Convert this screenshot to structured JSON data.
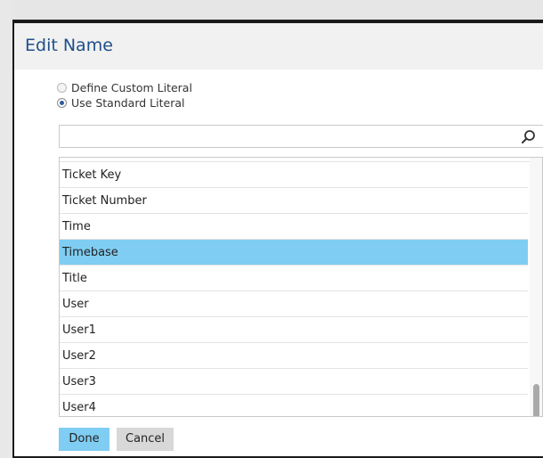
{
  "dialog": {
    "title": "Edit Name",
    "options": [
      {
        "label": "Define Custom Literal",
        "checked": false
      },
      {
        "label": "Use Standard Literal",
        "checked": true
      }
    ],
    "search": {
      "value": "",
      "placeholder": ""
    },
    "list": [
      {
        "label": "Ticket Key",
        "selected": false
      },
      {
        "label": "Ticket Number",
        "selected": false
      },
      {
        "label": "Time",
        "selected": false
      },
      {
        "label": "Timebase",
        "selected": true
      },
      {
        "label": "Title",
        "selected": false
      },
      {
        "label": "User",
        "selected": false
      },
      {
        "label": "User1",
        "selected": false
      },
      {
        "label": "User2",
        "selected": false
      },
      {
        "label": "User3",
        "selected": false
      },
      {
        "label": "User4",
        "selected": false
      }
    ],
    "buttons": {
      "done_label": "Done",
      "cancel_label": "Cancel"
    }
  },
  "colors": {
    "title": "#1f4f8a",
    "selection": "#7fcdf2",
    "done_button": "#7fcdf2",
    "cancel_button": "#d8d8d8"
  }
}
